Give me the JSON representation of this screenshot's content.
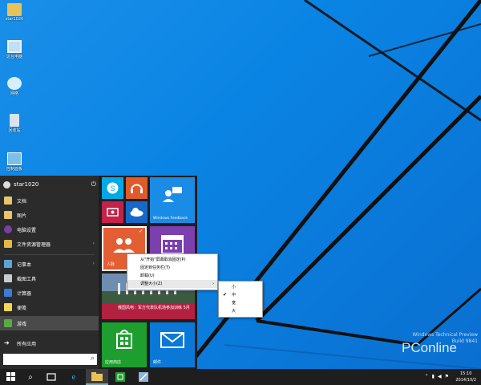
{
  "desktop": {
    "icons": [
      {
        "label": "star1020"
      },
      {
        "label": "这台电脑"
      },
      {
        "label": "网络"
      },
      {
        "label": "回收站"
      },
      {
        "label": "控制面板"
      }
    ]
  },
  "start_menu": {
    "user": {
      "name": "star1020"
    },
    "items": [
      {
        "label": "文档"
      },
      {
        "label": "图片"
      },
      {
        "label": "电脑设置"
      },
      {
        "label": "文件资源管理器"
      },
      {
        "label": "记事本"
      },
      {
        "label": "截图工具"
      },
      {
        "label": "计算器"
      },
      {
        "label": "便笺"
      },
      {
        "label": "游戏"
      },
      {
        "label": "所有应用"
      }
    ],
    "tiles": {
      "windows_feedback": "Windows Feedback",
      "people": "人脉",
      "news": "俄国风电：军方代表队机场参加训练 5月",
      "store": "应用商店",
      "mail": "邮件"
    }
  },
  "context_menu": {
    "items": [
      {
        "label": "从\"开始\"屏幕取消固定(P)"
      },
      {
        "label": "固定到任务栏(T)"
      },
      {
        "label": "卸载(U)"
      },
      {
        "label": "调整大小(Z)"
      }
    ]
  },
  "submenu": {
    "items": [
      {
        "label": "小"
      },
      {
        "label": "中",
        "checked": true
      },
      {
        "label": "宽"
      },
      {
        "label": "大"
      }
    ]
  },
  "watermark": {
    "line1": "Windows Technical Preview",
    "line2": "Build 9841",
    "brand": "PConline"
  },
  "taskbar": {
    "time": "15:10",
    "date": "2014/10/2"
  }
}
